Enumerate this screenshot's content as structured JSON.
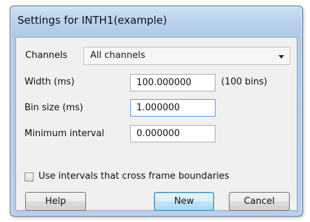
{
  "window": {
    "title": "Settings for INTH1(example)"
  },
  "channels": {
    "label": "Channels",
    "selected": "All channels"
  },
  "width": {
    "label": "Width (ms)",
    "value": "100.000000",
    "note": "(100 bins)"
  },
  "bin_size": {
    "label": "Bin size (ms)",
    "value": "1.000000"
  },
  "min_interval": {
    "label": "Minimum interval",
    "value": "0.000000"
  },
  "cross_frames": {
    "label": "Use intervals that cross frame boundaries",
    "checked": false
  },
  "buttons": {
    "help": "Help",
    "new": "New",
    "cancel": "Cancel"
  }
}
